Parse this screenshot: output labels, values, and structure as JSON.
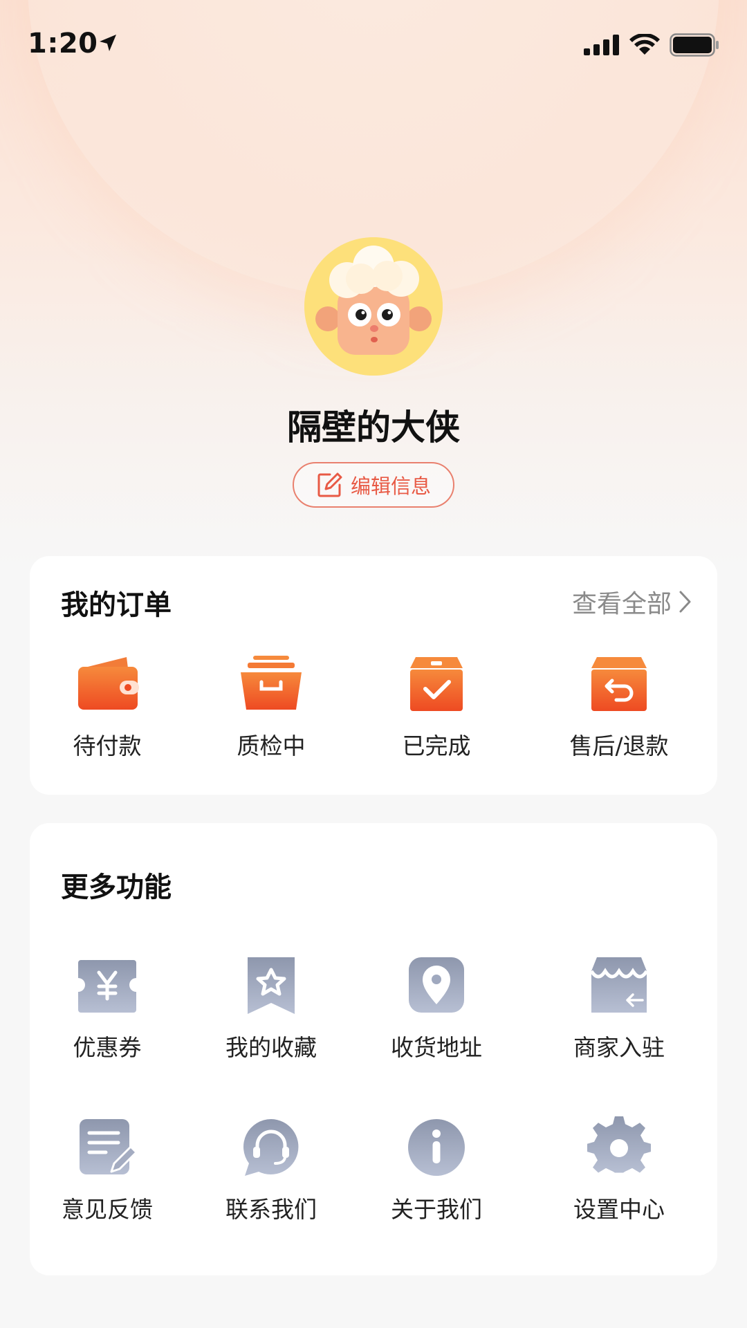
{
  "status_bar": {
    "time": "1:20"
  },
  "profile": {
    "username": "隔壁的大侠",
    "edit_label": "编辑信息"
  },
  "orders": {
    "title": "我的订单",
    "view_all_label": "查看全部",
    "items": [
      {
        "label": "待付款",
        "icon": "wallet-icon"
      },
      {
        "label": "质检中",
        "icon": "inspection-box-icon"
      },
      {
        "label": "已完成",
        "icon": "completed-box-icon"
      },
      {
        "label": "售后/退款",
        "icon": "refund-box-icon"
      }
    ]
  },
  "more": {
    "title": "更多功能",
    "items": [
      {
        "label": "优惠券",
        "icon": "coupon-icon"
      },
      {
        "label": "我的收藏",
        "icon": "favorites-icon"
      },
      {
        "label": "收货地址",
        "icon": "location-icon"
      },
      {
        "label": "商家入驻",
        "icon": "store-icon"
      },
      {
        "label": "意见反馈",
        "icon": "feedback-icon"
      },
      {
        "label": "联系我们",
        "icon": "customer-service-icon"
      },
      {
        "label": "关于我们",
        "icon": "info-icon"
      },
      {
        "label": "设置中心",
        "icon": "settings-gear-icon"
      }
    ]
  },
  "colors": {
    "accent": "#f05a2a",
    "accent_light": "#f68a3c",
    "icon_gray": "#9aa3ba",
    "text_primary": "#111111",
    "text_secondary": "#8a8a8a"
  }
}
